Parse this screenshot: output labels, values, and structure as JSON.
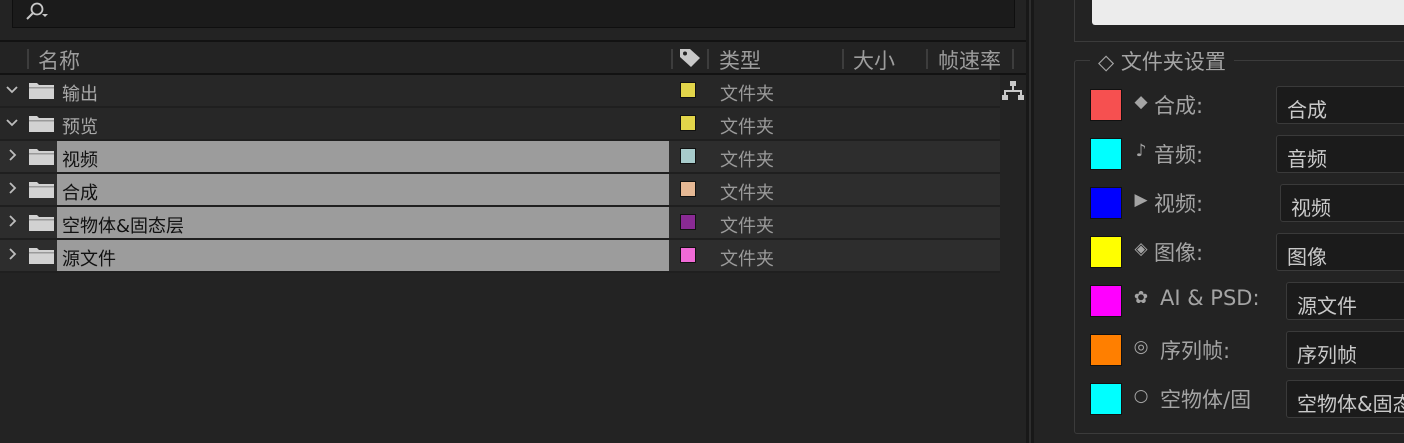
{
  "search": {
    "placeholder": ""
  },
  "columns": {
    "name": "名称",
    "type": "类型",
    "size": "大小",
    "framerate": "帧速率"
  },
  "rows": [
    {
      "name": "输出",
      "type": "文件夹",
      "expanded": true,
      "selected": false,
      "label_color": "#e2d54a"
    },
    {
      "name": "预览",
      "type": "文件夹",
      "expanded": true,
      "selected": false,
      "label_color": "#e2d54a"
    },
    {
      "name": "视频",
      "type": "文件夹",
      "expanded": false,
      "selected": true,
      "label_color": "#a8cccc"
    },
    {
      "name": "合成",
      "type": "文件夹",
      "expanded": false,
      "selected": true,
      "label_color": "#e5b894"
    },
    {
      "name": "空物体&固态层",
      "type": "文件夹",
      "expanded": false,
      "selected": true,
      "label_color": "#8a2a94"
    },
    {
      "name": "源文件",
      "type": "文件夹",
      "expanded": false,
      "selected": true,
      "label_color": "#f06ad6"
    }
  ],
  "settings": {
    "group_title": "◇ 文件夹设置",
    "items": [
      {
        "symbol": "◆",
        "label": "合成:",
        "value": "合成",
        "color": "#f65050"
      },
      {
        "symbol": "♪",
        "label": "音频:",
        "value": "音频",
        "color": "#00ffff"
      },
      {
        "symbol": "▶",
        "label": "视频:",
        "value": "视频",
        "color": "#0000ff"
      },
      {
        "symbol": "◈",
        "label": "图像:",
        "value": "图像",
        "color": "#ffff00"
      },
      {
        "symbol": "✿",
        "label": "AI & PSD:",
        "value": "源文件",
        "color": "#ff00ff"
      },
      {
        "symbol": "◎",
        "label": "序列帧:",
        "value": "序列帧",
        "color": "#ff7f00"
      },
      {
        "symbol": "○",
        "label": "空物体/固",
        "value": "空物体&固态层",
        "color": "#00ffff"
      }
    ]
  },
  "icons": {
    "search": "search-icon",
    "tag": "label-tag-icon",
    "folder": "folder-icon",
    "flowchart": "flowchart-icon"
  }
}
